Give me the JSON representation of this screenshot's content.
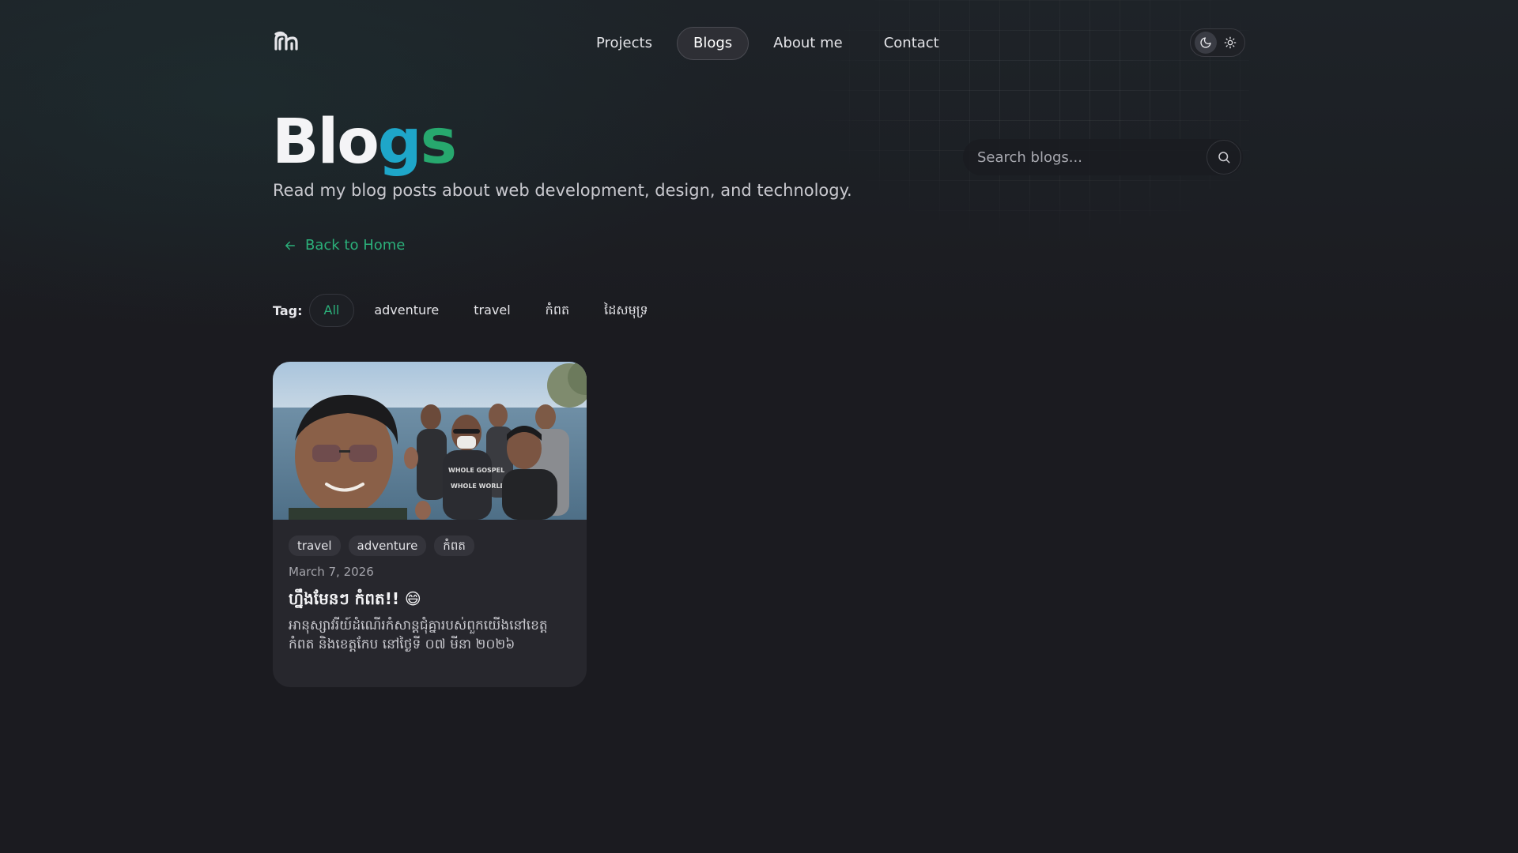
{
  "header": {
    "logo_text": "ស",
    "nav": [
      {
        "label": "Projects",
        "active": false
      },
      {
        "label": "Blogs",
        "active": true
      },
      {
        "label": "About me",
        "active": false
      },
      {
        "label": "Contact",
        "active": false
      }
    ],
    "theme_toggle": {
      "options": [
        "moon-icon",
        "sun-icon"
      ],
      "selected": "dark"
    }
  },
  "hero": {
    "title_part1": "Blo",
    "title_part2": "g",
    "title_part3": "s",
    "subtitle": "Read my blog posts about web development, design, and technology."
  },
  "search": {
    "placeholder": "Search blogs..."
  },
  "back_link": {
    "label": "Back to Home"
  },
  "tags": {
    "label": "Tag:",
    "items": [
      "All",
      "adventure",
      "travel",
      "កំពត",
      "ដៃសមុទ្រ"
    ],
    "selected": "All"
  },
  "posts": [
    {
      "image_alt": "Group selfie by the sea",
      "tags": [
        "travel",
        "adventure",
        "កំពត"
      ],
      "date": "March 7, 2026",
      "title": "ហ្នឹងមែនៗ កំពត!! 😄",
      "description": "អានុស្សាវរីយ៍ដំណើរកំសាន្តជុំគ្នារបស់ពួកយើងនៅខេត្តកំពត និងខេត្តកែប នៅថ្ងៃទី ០៧ មីនា ២០២៦"
    }
  ],
  "colors": {
    "accent_green": "#27a86e",
    "accent_blue": "#1ea6c9",
    "background": "#1b1b20",
    "card": "#27272d"
  }
}
